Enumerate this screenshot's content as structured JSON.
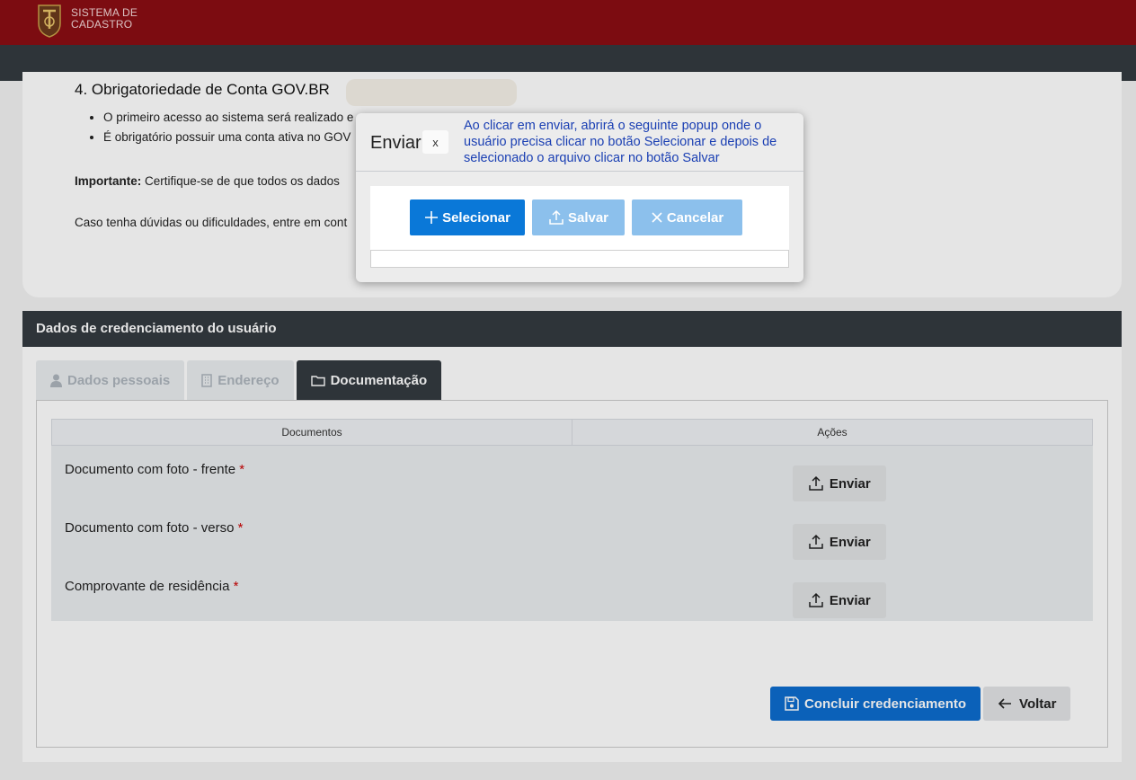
{
  "header": {
    "brand_line1": "SISTEMA DE",
    "brand_line2": "CADASTRO"
  },
  "info": {
    "heading": "4. Obrigatoriedade de Conta GOV.BR",
    "bullets": [
      "O primeiro acesso ao sistema será realizado e",
      "É obrigatório possuir uma conta ativa no GOV"
    ],
    "important_label": "Importante:",
    "important_text": " Certifique-se de que todos os dados",
    "doubts_text": "Caso tenha dúvidas ou dificuldades, entre em cont"
  },
  "credential": {
    "title": "Dados de credenciamento do usuário",
    "tabs": [
      "Dados pessoais",
      "Endereço",
      "Documentação"
    ],
    "active_tab": "Documentação",
    "table": {
      "col_docs": "Documentos",
      "col_actions": "Ações",
      "rows": [
        {
          "label": "Documento com foto - frente",
          "req": "*",
          "action": "Enviar"
        },
        {
          "label": "Documento com foto - verso",
          "req": "*",
          "action": "Enviar"
        },
        {
          "label": "Comprovante de residência",
          "req": "*",
          "action": "Enviar"
        }
      ]
    },
    "finish_label": "Concluir credenciamento",
    "back_label": "Voltar"
  },
  "modal": {
    "title": "Enviar",
    "close_label": "x",
    "annotation": "Ao clicar em enviar, abrirá o seguinte popup onde o usuário precisa clicar no botão Selecionar e depois de selecionado o arquivo clicar no botão Salvar",
    "select_label": "Selecionar",
    "save_label": "Salvar",
    "cancel_label": "Cancelar"
  },
  "colors": {
    "header_red": "#8b0e14",
    "navbar_dark": "#343a40",
    "primary_blue": "#0d6ccf",
    "annotation_blue": "#1a3fb3"
  }
}
